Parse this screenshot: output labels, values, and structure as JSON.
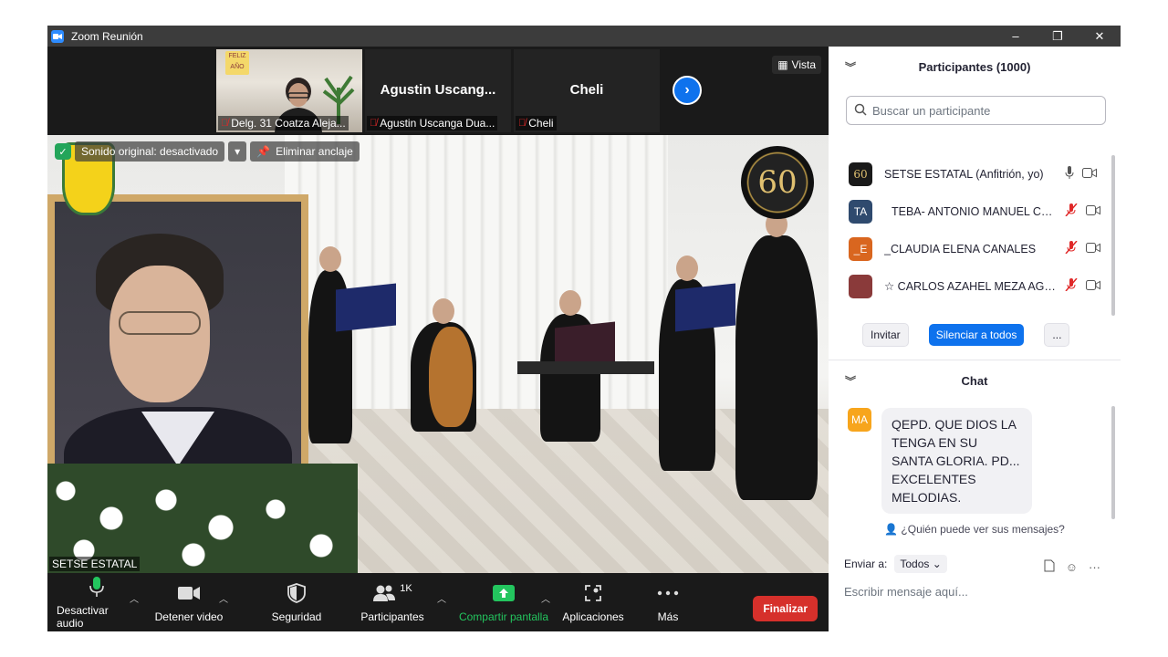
{
  "window": {
    "title": "Zoom Reunión",
    "min": "–",
    "restore": "❐",
    "close": "✕"
  },
  "strip": {
    "tiles": [
      {
        "type": "video",
        "label": "Delg. 31 Coatza Aleja...",
        "sign_text": "FELIZ AÑO"
      },
      {
        "type": "name",
        "name": "Agustin  Uscang...",
        "label": "Agustin Uscanga Dua..."
      },
      {
        "type": "name",
        "name": "Cheli",
        "label": "Cheli"
      }
    ],
    "view_label": "Vista"
  },
  "main_video": {
    "audio_status": "Sonido original: desactivado",
    "unpin_label": "Eliminar anclaje",
    "speaker": "SETSE ESTATAL",
    "logo_number": "60"
  },
  "toolbar": {
    "items": [
      {
        "label": "Desactivar audio",
        "icon": "microphone-icon"
      },
      {
        "label": "Detener video",
        "icon": "video-camera-icon"
      },
      {
        "label": "Seguridad",
        "icon": "shield-icon"
      },
      {
        "label": "Participantes",
        "icon": "participants-icon",
        "count": "1K"
      },
      {
        "label": "Compartir pantalla",
        "icon": "share-screen-icon"
      },
      {
        "label": "Aplicaciones",
        "icon": "apps-icon"
      },
      {
        "label": "Más",
        "icon": "more-icon"
      }
    ],
    "end_label": "Finalizar"
  },
  "participants": {
    "header": "Participantes (1000)",
    "search_placeholder": "Buscar un participante",
    "list": [
      {
        "avatar_text": "60",
        "avatar_color": "#1a1a1a",
        "name": "SETSE ESTATAL (Anfitrión, yo)",
        "muted": false
      },
      {
        "avatar_text": "TA",
        "avatar_color": "#2f4a6e",
        "name": "TEBA- ANTONIO MANUEL CO...",
        "muted": true
      },
      {
        "avatar_text": "_E",
        "avatar_color": "#d9661f",
        "name": "_CLAUDIA ELENA CANALES",
        "muted": true
      },
      {
        "avatar_text": "",
        "avatar_color": "#8a3a3a",
        "name": "☆ CARLOS AZAHEL MEZA AGU...",
        "muted": true
      }
    ],
    "invite": "Invitar",
    "mute_all": "Silenciar a todos",
    "more": "..."
  },
  "chat": {
    "header": "Chat",
    "messages": [
      {
        "avatar_text": "MA",
        "text": "QEPD. QUE DIOS LA TENGA EN SU SANTA GLORIA. PD... EXCELENTES MELODIAS."
      }
    ],
    "who_can_see": "¿Quién puede ver sus mensajes?",
    "send_to_label": "Enviar a:",
    "send_to_value": "Todos",
    "input_placeholder": "Escribir mensaje aquí..."
  },
  "colors": {
    "zoom_blue": "#0e72ed",
    "end_red": "#d6302b",
    "share_green": "#23c55e",
    "muted_red": "#e02828"
  }
}
